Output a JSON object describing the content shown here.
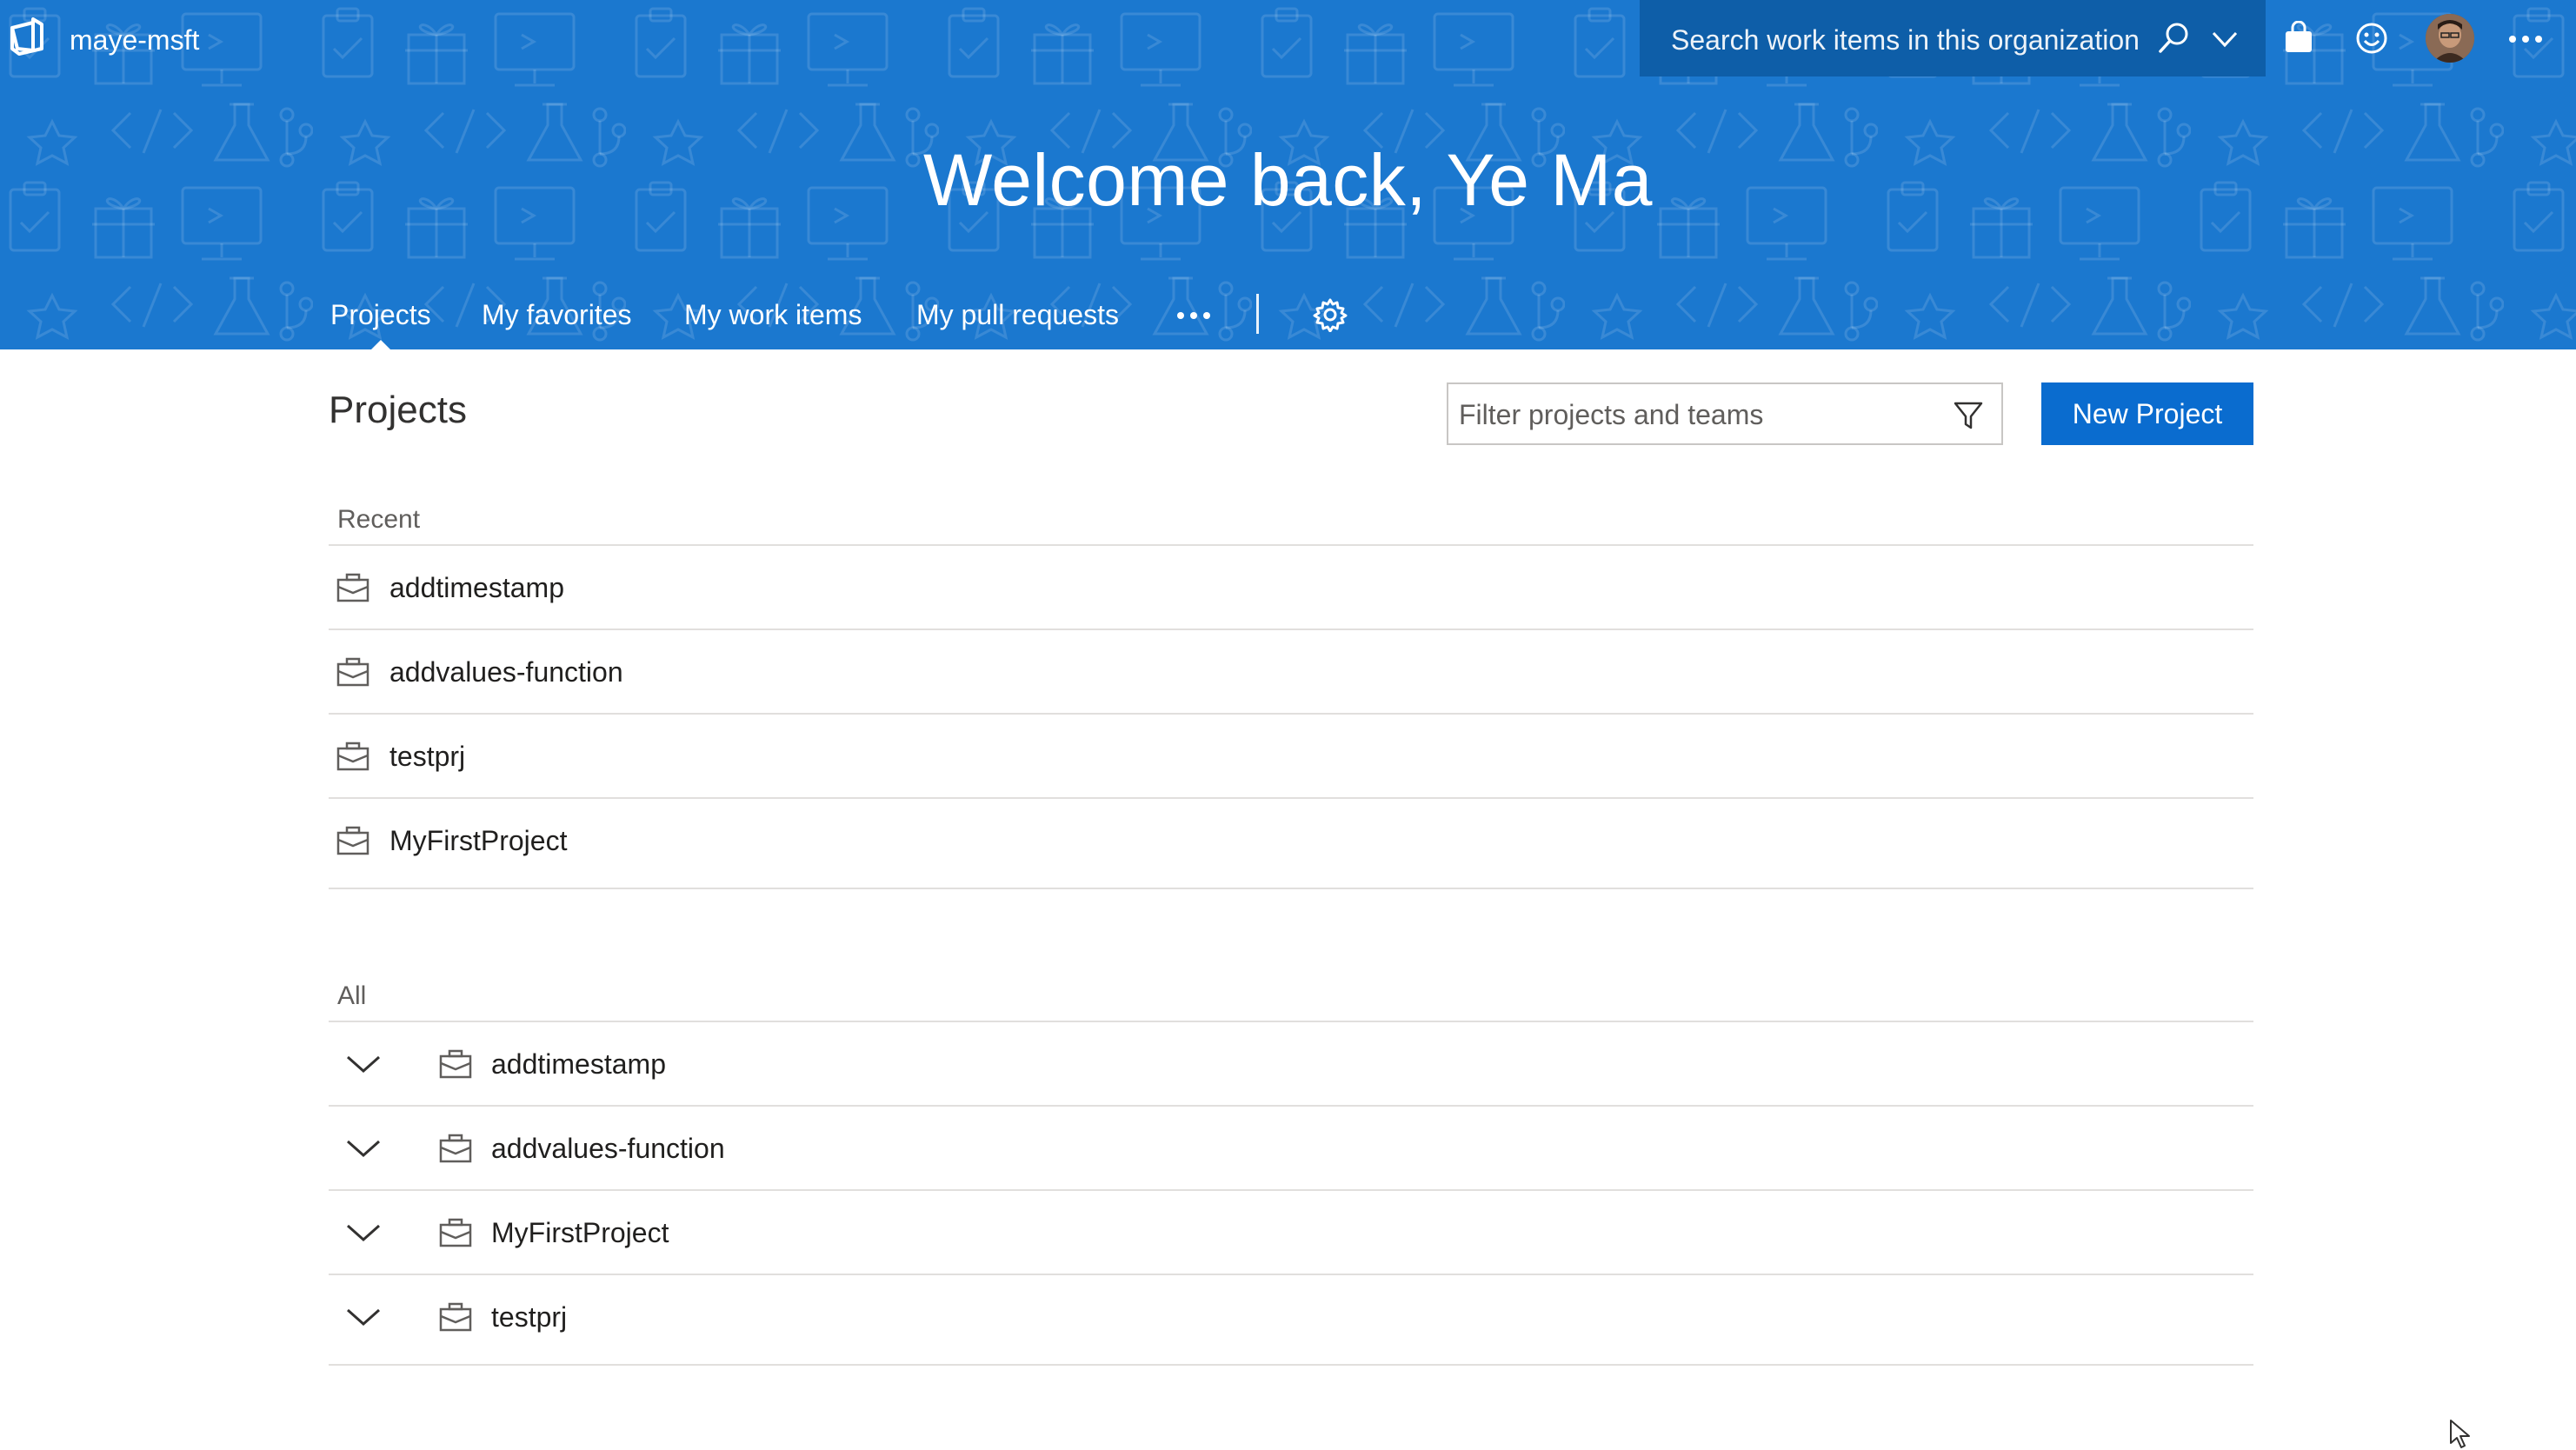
{
  "app": {
    "org_name": "maye-msft",
    "brand_color": "#1b78cf"
  },
  "search": {
    "placeholder": "Search work items in this organization"
  },
  "header": {
    "welcome": "Welcome back, Ye Ma"
  },
  "nav": {
    "tabs": [
      {
        "label": "Projects",
        "selected": true
      },
      {
        "label": "My favorites",
        "selected": false
      },
      {
        "label": "My work items",
        "selected": false
      },
      {
        "label": "My pull requests",
        "selected": false
      }
    ],
    "more_icon": "ellipsis-icon",
    "settings_icon": "gear-icon"
  },
  "main": {
    "title": "Projects",
    "filter_placeholder": "Filter projects and teams",
    "new_project_label": "New Project",
    "recent": {
      "label": "Recent",
      "items": [
        "addtimestamp",
        "addvalues-function",
        "testprj",
        "MyFirstProject"
      ]
    },
    "all": {
      "label": "All",
      "items": [
        "addtimestamp",
        "addvalues-function",
        "MyFirstProject",
        "testprj"
      ]
    }
  }
}
